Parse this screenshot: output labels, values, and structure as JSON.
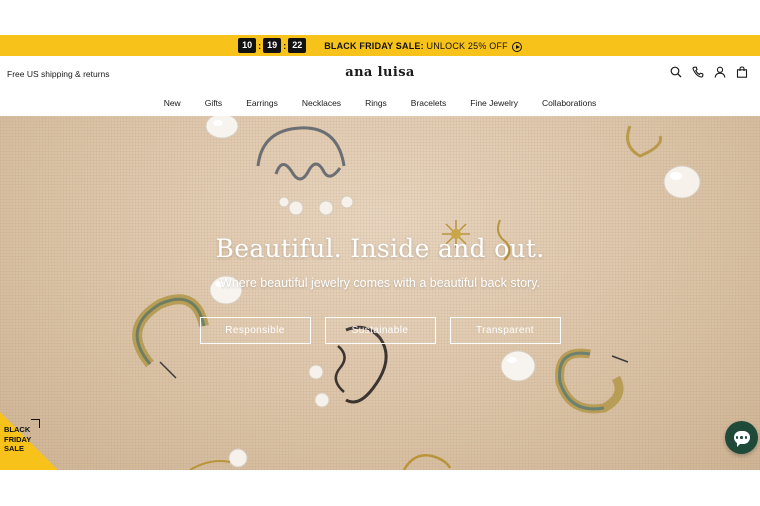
{
  "promo": {
    "timer": {
      "hours": "10",
      "minutes": "19",
      "seconds": "22"
    },
    "text_bold": "BLACK FRIDAY SALE:",
    "text": " UNLOCK 25% OFF"
  },
  "header": {
    "shipping": "Free US shipping & returns",
    "logo": "ana luisa",
    "icons": [
      "search-icon",
      "phone-icon",
      "account-icon",
      "bag-icon"
    ]
  },
  "nav": {
    "items": [
      "New",
      "Gifts",
      "Earrings",
      "Necklaces",
      "Rings",
      "Bracelets",
      "Fine Jewelry",
      "Collaborations"
    ]
  },
  "hero": {
    "title": "Beautiful. Inside and out.",
    "subtitle": "Where beautiful jewelry comes with a beautiful back story.",
    "buttons": [
      "Responsible",
      "Sustainable",
      "Transparent"
    ]
  },
  "badge": {
    "line1": "BLACK",
    "line2": "FRIDAY",
    "line3": "SALE"
  },
  "colors": {
    "promo_bg": "#f7c21a",
    "chat_bg": "#1f4a3a"
  }
}
